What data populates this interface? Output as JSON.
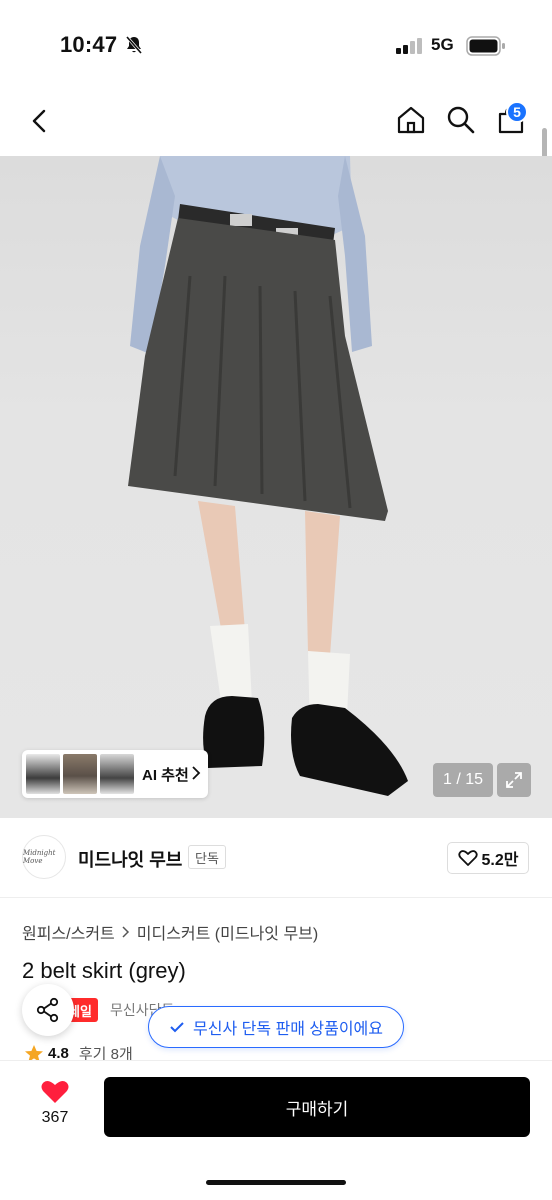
{
  "status": {
    "time": "10:47",
    "network": "5G"
  },
  "nav": {
    "cart_count": "5"
  },
  "gallery": {
    "ai_label": "AI 추천",
    "counter": "1 / 15"
  },
  "brand": {
    "logo_text": "Midnight Move",
    "name": "미드나잇 무브",
    "tag": "단독",
    "likes": "5.2만"
  },
  "product": {
    "breadcrumb": [
      "원피스/스커트",
      "미디스커트 (미드나잇 무브)"
    ],
    "title": "2 belt skirt (grey)",
    "sale_tag": "세일",
    "only_tag": "무신사단독",
    "exclusive_pill": "무신사 단독 판매 상품이에요",
    "rating": "4.8",
    "reviews": "후기 8개"
  },
  "bottom": {
    "heart_count": "367",
    "buy_label": "구매하기"
  },
  "colors": {
    "accent_blue": "#1e5df0",
    "sale_red": "#ff2b2b",
    "heart_red": "#ff1f3d",
    "star": "#f5a623"
  }
}
